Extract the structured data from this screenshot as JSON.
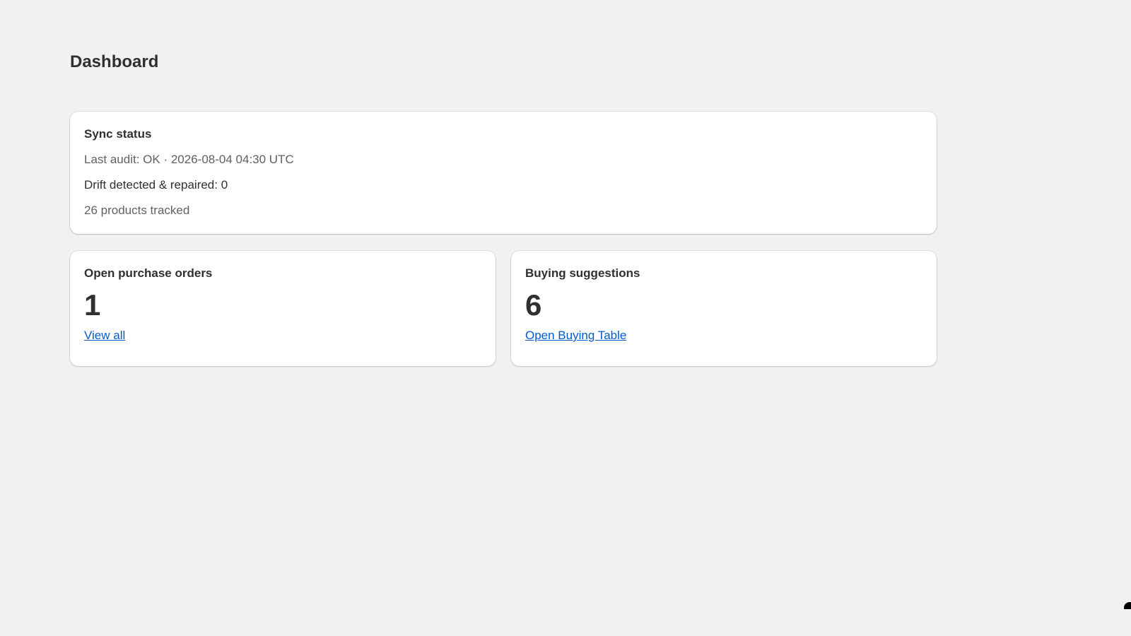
{
  "page": {
    "title": "Dashboard"
  },
  "sync_card": {
    "heading": "Sync status",
    "last_audit": "Last audit: OK · 2026-08-04 04:30 UTC",
    "drift": "Drift detected & repaired: 0",
    "products_tracked": "26 products tracked"
  },
  "purchase_orders_card": {
    "heading": "Open purchase orders",
    "count": "1",
    "link_label": "View all"
  },
  "buying_card": {
    "heading": "Buying suggestions",
    "count": "6",
    "link_label": "Open Buying Table"
  },
  "colors": {
    "background": "#f1f1f1",
    "card": "#ffffff",
    "text": "#303030",
    "muted_text": "#616161",
    "link": "#005bd3"
  }
}
